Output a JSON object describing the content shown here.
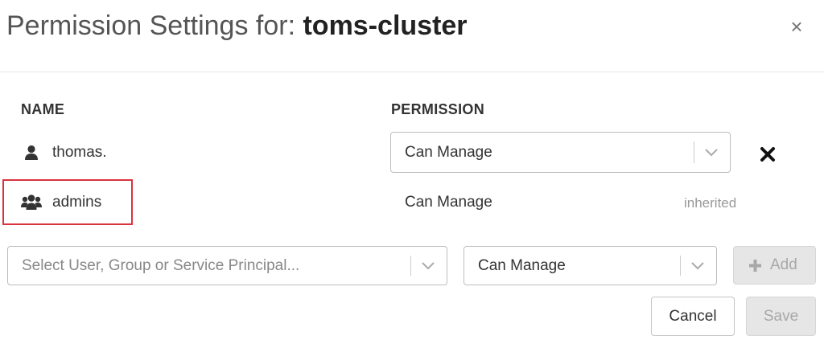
{
  "dialog": {
    "title_prefix": "Permission Settings for: ",
    "cluster_name": "toms-cluster",
    "close_glyph": "×"
  },
  "table": {
    "columns": [
      "NAME",
      "PERMISSION"
    ],
    "rows": [
      {
        "icon": "user-icon",
        "name": "thomas.",
        "permission": "Can Manage",
        "editable": true
      },
      {
        "icon": "group-icon",
        "name": "admins",
        "permission": "Can Manage",
        "note": "inherited",
        "editable": false
      }
    ]
  },
  "add_row": {
    "principal_placeholder": "Select User, Group or Service Principal...",
    "permission_value": "Can Manage",
    "add_label": "Add",
    "add_icon": "plus-icon"
  },
  "footer": {
    "cancel_label": "Cancel",
    "save_label": "Save"
  },
  "colors": {
    "highlight": "#d9333f",
    "disabled_bg": "#e6e6e6",
    "border": "#bdbdbd"
  }
}
